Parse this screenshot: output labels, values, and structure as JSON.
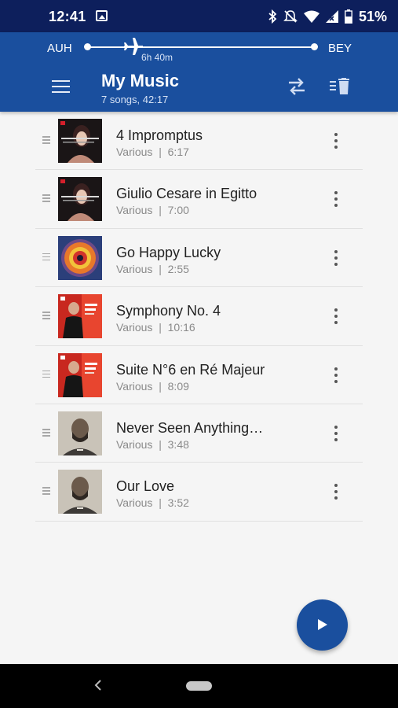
{
  "status_bar": {
    "time": "12:41",
    "battery": "51%",
    "icons": [
      "image-icon",
      "bluetooth-icon",
      "silent-icon",
      "wifi-icon",
      "signal-icon",
      "battery-icon"
    ]
  },
  "flight": {
    "from": "AUH",
    "to": "BEY",
    "remaining": "6h 40m",
    "progress": 0.2
  },
  "header": {
    "title": "My Music",
    "subtitle": "7 songs, 42:17",
    "icons": [
      "menu-icon",
      "swap-icon",
      "clear-playlist-icon"
    ]
  },
  "songs": [
    {
      "title": "4 Impromptus",
      "artist": "Various",
      "separator": "|",
      "duration": "6:17",
      "cover": "soprano"
    },
    {
      "title": "Giulio Cesare in Egitto",
      "artist": "Various",
      "separator": "|",
      "duration": "7:00",
      "cover": "soprano"
    },
    {
      "title": "Go Happy Lucky",
      "artist": "Various",
      "separator": "|",
      "duration": "2:55",
      "cover": "circle"
    },
    {
      "title": "Symphony No. 4",
      "artist": "Various",
      "separator": "|",
      "duration": "10:16",
      "cover": "conductor"
    },
    {
      "title": "Suite N°6 en Ré Majeur",
      "artist": "Various",
      "separator": "|",
      "duration": "8:09",
      "cover": "conductor"
    },
    {
      "title": "Never Seen Anything…",
      "artist": "Various",
      "separator": "|",
      "duration": "3:48",
      "cover": "portrait"
    },
    {
      "title": "Our Love",
      "artist": "Various",
      "separator": "|",
      "duration": "3:52",
      "cover": "portrait"
    }
  ],
  "fab": {
    "icon": "play-icon"
  },
  "nav": {
    "icons": [
      "back-icon",
      "home-pill"
    ]
  },
  "colors": {
    "status_bar": "#0d1f5c",
    "header": "#1a4f9e",
    "fab": "#1a4f9e",
    "background": "#f5f5f5"
  }
}
